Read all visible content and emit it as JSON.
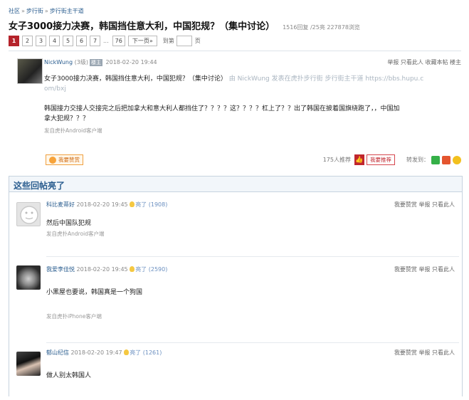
{
  "breadcrumb": [
    "社区",
    "步行街",
    "步行街主干道"
  ],
  "title": "女子3000接力决赛，韩国挡住意大利，中国犯规？（集中讨论）",
  "title_stats": "1516回复 /25亮  227878浏览",
  "pagination": {
    "pages": [
      "1",
      "2",
      "3",
      "4",
      "5",
      "6",
      "7"
    ],
    "ellipsis": "...",
    "last": "76",
    "next": "下一页»",
    "goto_label": "到第",
    "goto_unit": "页"
  },
  "main_post": {
    "user": "NickWung",
    "level": "(3级)",
    "badge": "楼主",
    "time": "2018-02-20 19:44",
    "actions": [
      "举报",
      "只看此人",
      "收藏本帖",
      "楼主"
    ],
    "line1": "女子3000接力决赛，韩国挡住意大利，中国犯规？（集中讨论）",
    "quote_line1": "由 NickWung 发表在虎扑步行街 步行街主干道 https://bbs.hupu.c",
    "quote_line2": "om/bxj",
    "body_line1": "韩国接力交接人交接完之后把加拿大和意大利人都挡住了？？？？这？？？？杠上了？？出了韩国在披着国旗绕跑了，，中国加",
    "body_line2": "拿大犯规？？？",
    "device": "发自虎扑Android客户端",
    "cheer_label": "我要赞赏",
    "rec_count": "175人推荐",
    "rec_label": "我要推荐",
    "share_label": "转发到："
  },
  "highlight": {
    "title": "这些回帖亮了",
    "replies": [
      {
        "user": "科比麦蒂好",
        "time": "2018-02-20 19:45",
        "light_label": "亮了",
        "light_count": "(1908)",
        "text": "然后中国队犯规",
        "device": "发自虎扑Android客户端",
        "actions": [
          "我要赞赏",
          "举报",
          "只看此人"
        ]
      },
      {
        "user": "我爱李佳悦",
        "time": "2018-02-20 19:45",
        "light_label": "亮了",
        "light_count": "(2590)",
        "text": "小黑屋也要说，韩国真是一个狗国",
        "device": "发自虎扑iPhone客户端",
        "actions": [
          "我要赞赏",
          "举报",
          "只看此人"
        ]
      },
      {
        "user": "郁山纪信",
        "time": "2018-02-20 19:47",
        "light_label": "亮了",
        "light_count": "(1261)",
        "text": "做人别太韩国人",
        "device": "",
        "actions": [
          "我要赞赏",
          "举报",
          "只看此人"
        ]
      }
    ]
  }
}
